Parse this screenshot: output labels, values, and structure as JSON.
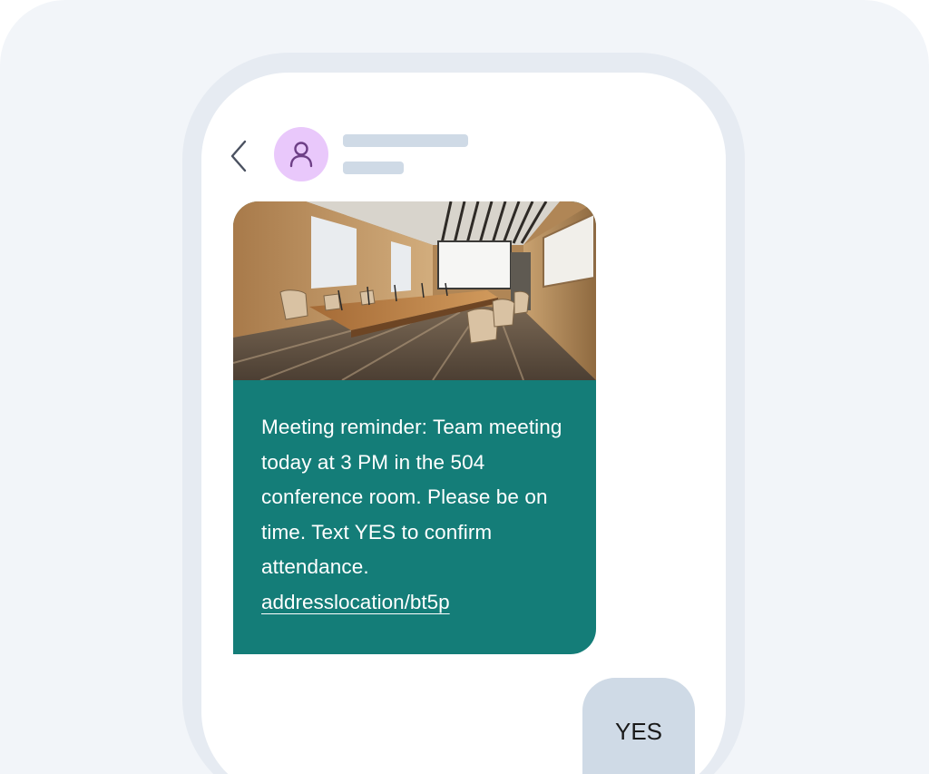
{
  "header": {
    "back_icon": "chevron-left-icon",
    "avatar_icon": "user-icon",
    "avatar_color": "#e9c8fb",
    "placeholder_color": "#cfdae6"
  },
  "message": {
    "image_subject": "conference room",
    "text": "Meeting reminder: Team meeting today at 3 PM in the 504 conference room. Please be on time. Text YES to confirm attendance.",
    "link": "addresslocation/bt5p",
    "bubble_color": "#147d78"
  },
  "reply": {
    "text": "YES",
    "bubble_color": "#cfdae6"
  }
}
